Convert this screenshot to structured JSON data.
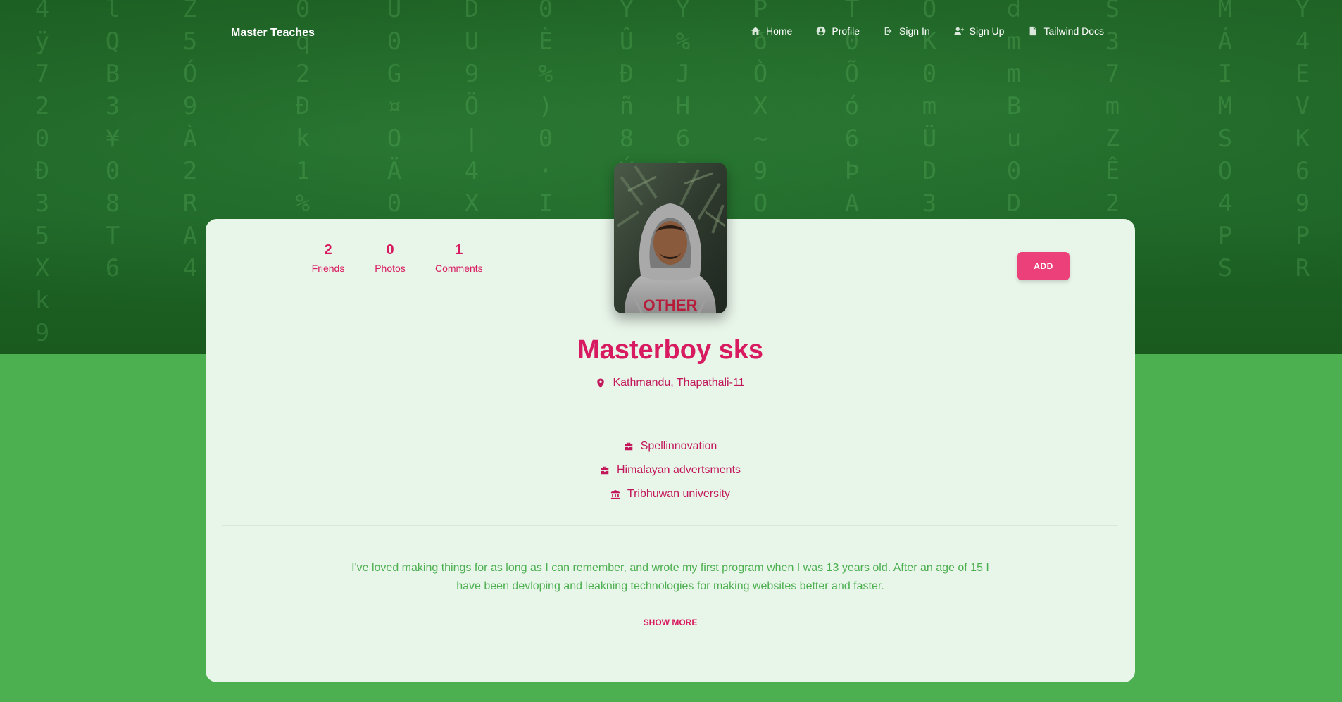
{
  "navbar": {
    "brand": "Master Teaches",
    "links": [
      {
        "label": "Home",
        "icon": "home-icon"
      },
      {
        "label": "Profile",
        "icon": "user-circle-icon"
      },
      {
        "label": "Sign In",
        "icon": "sign-in-icon"
      },
      {
        "label": "Sign Up",
        "icon": "user-plus-icon"
      },
      {
        "label": "Tailwind Docs",
        "icon": "file-icon"
      }
    ]
  },
  "profile": {
    "stats": [
      {
        "value": "2",
        "label": "Friends"
      },
      {
        "value": "0",
        "label": "Photos"
      },
      {
        "value": "1",
        "label": "Comments"
      }
    ],
    "add_label": "ADD",
    "name": "Masterboy sks",
    "location": "Kathmandu, Thapathali-11",
    "organizations": [
      {
        "label": "Spellinnovation",
        "icon": "briefcase-icon"
      },
      {
        "label": "Himalayan advertsments",
        "icon": "briefcase-icon"
      },
      {
        "label": "Tribhuwan university",
        "icon": "university-icon"
      }
    ],
    "bio": "I've loved making things for as long as I can remember, and wrote my first program when I was 13 years old. After an age of 15 I have been devloping and leakning technologies for making websites better and faster.",
    "show_more_label": "SHOW MORE"
  },
  "colors": {
    "accent": "#d81b60",
    "button": "#ec407a",
    "page_bg": "#4caf50",
    "hero_bg": "#1b5e20",
    "card_bg": "#e8f5e9"
  }
}
